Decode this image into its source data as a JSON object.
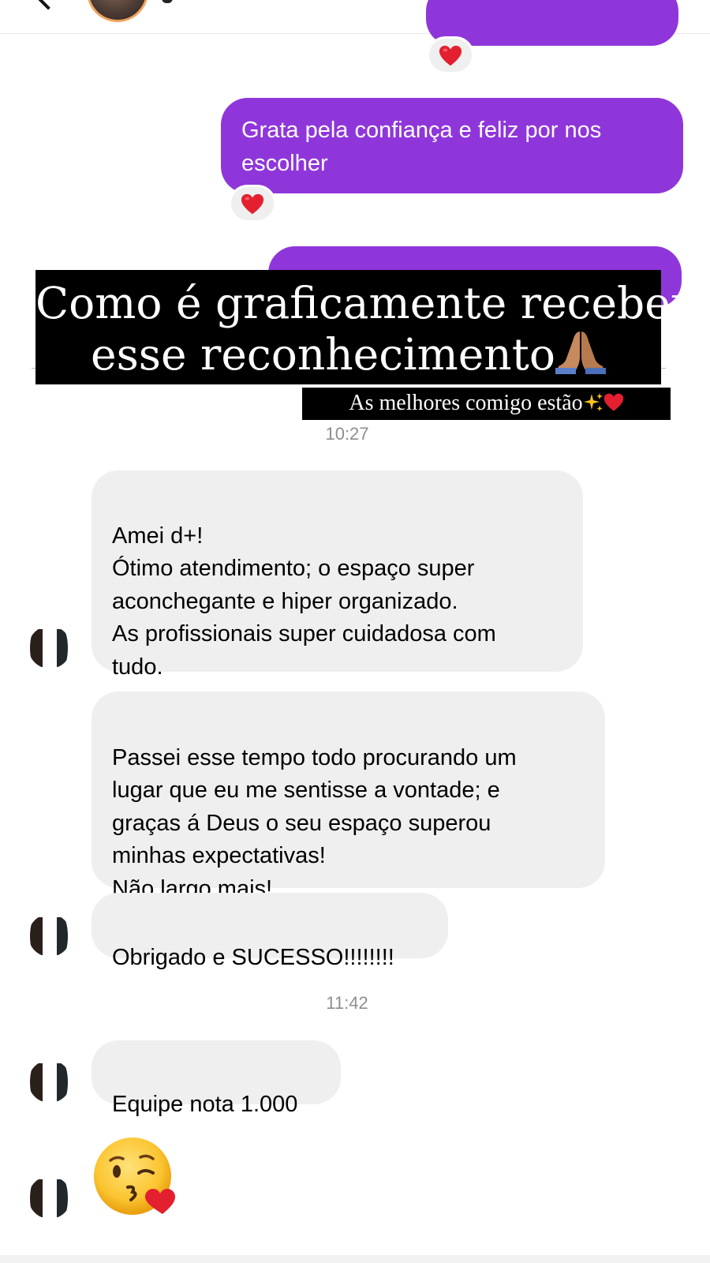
{
  "header": {
    "back_icon": "chevron-left-icon",
    "avatar_icon": "contact-avatar",
    "video_icon": "video-camera-icon",
    "call_icon": "phone-icon",
    "info_icon": "info-icon",
    "avatar_ring_color": "#f0a35e"
  },
  "colors": {
    "sent_bubble": "#8f36db",
    "received_bubble": "#efefef",
    "overlay_bg": "#000000",
    "timestamp": "#8e8e8e"
  },
  "thread": {
    "sent_1": {
      "text": "Grata pela confiança e feliz por nos escolher",
      "reaction": "heart-emoji"
    },
    "sent_top": {
      "reaction": "heart-emoji"
    }
  },
  "overlay": {
    "line_1": "Como é graficamente receber",
    "line_2": "esse reconhecimento",
    "line_2_emoji": "praying-hands-emoji",
    "caption": "As melhores comigo estão",
    "caption_emojis": [
      "sparkles-emoji",
      "red-heart-emoji"
    ]
  },
  "messages": {
    "time_1": "10:27",
    "msg_1": "Amei d+!\nÓtimo atendimento; o espaço super\naconchegante e hiper organizado.\nAs profissionais super cuidadosa com\ntudo.",
    "msg_2": "Passei esse tempo todo procurando um\nlugar que eu me sentisse a vontade; e\ngraças á Deus o seu espaço superou\nminhas expectativas!\nNão largo mais!",
    "msg_3": "Obrigado e SUCESSO!!!!!!!!",
    "time_2": "11:42",
    "msg_4": "Equipe nota 1.000",
    "msg_5_emoji": "face-blowing-a-kiss-emoji"
  }
}
